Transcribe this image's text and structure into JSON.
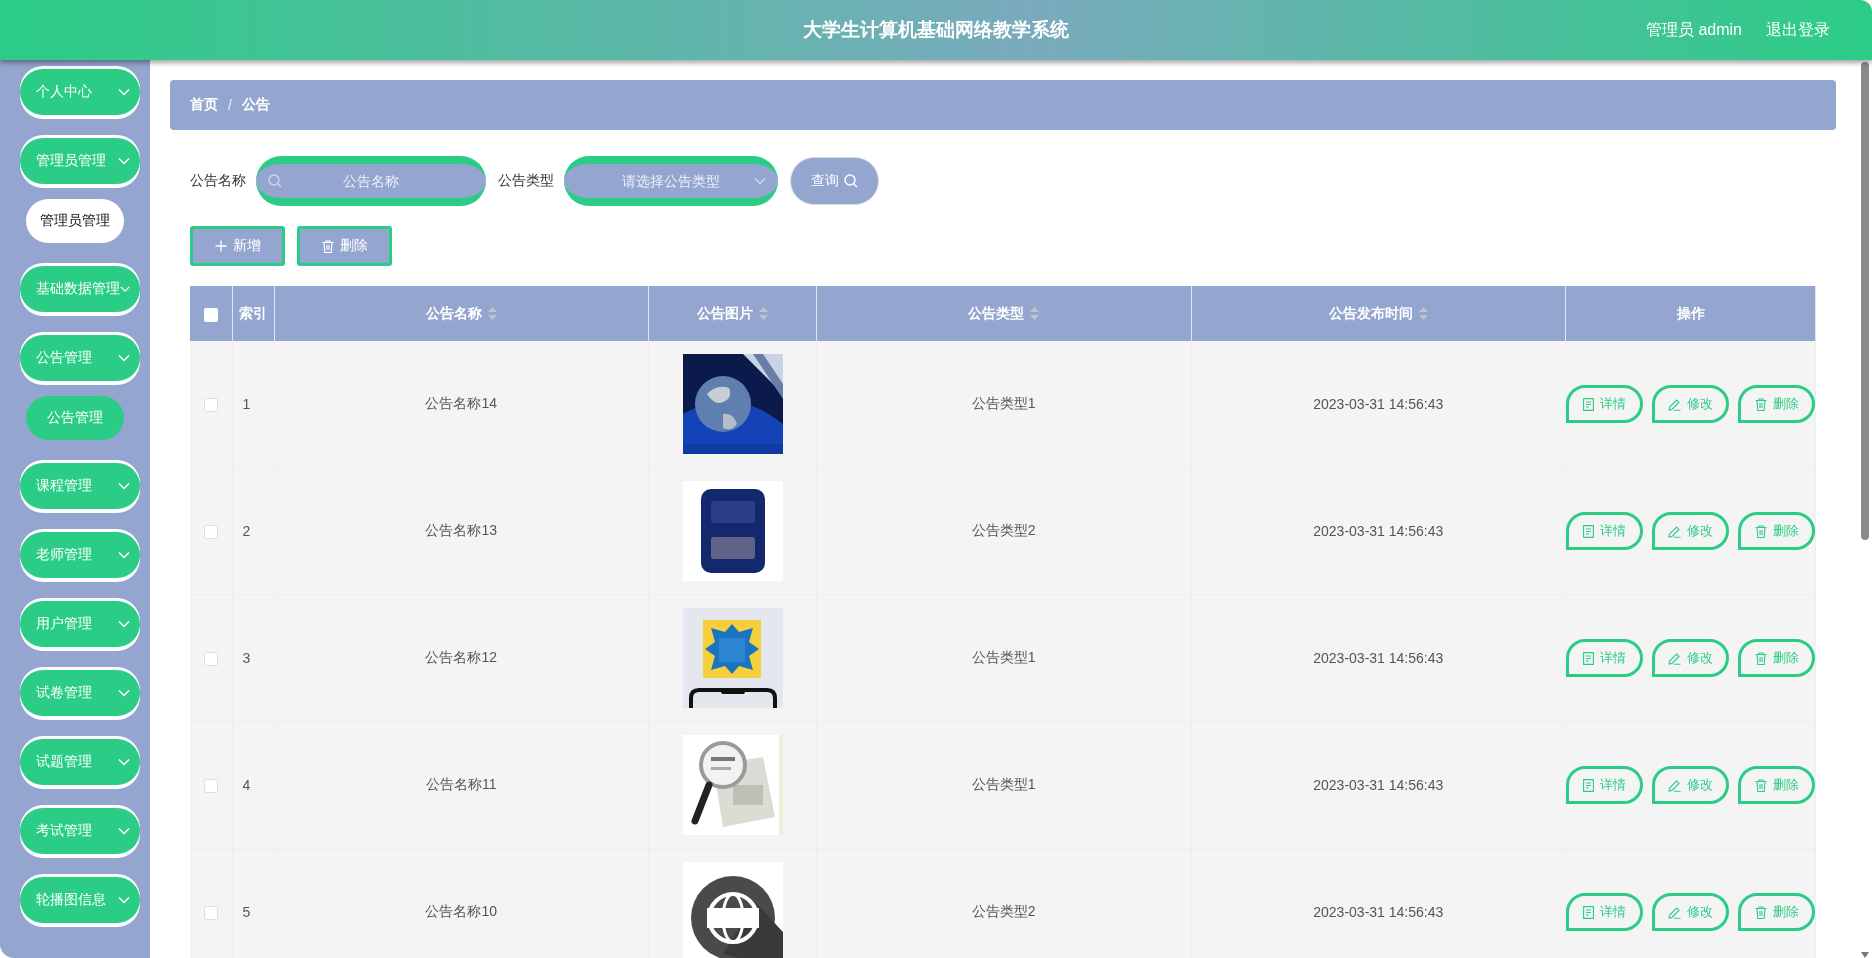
{
  "header": {
    "title": "大学生计算机基础网络教学系统",
    "user": "管理员 admin",
    "logout": "退出登录"
  },
  "sidebar": {
    "items": [
      {
        "label": "个人中心"
      },
      {
        "label": "管理员管理",
        "children": [
          {
            "label": "管理员管理",
            "selected": false
          }
        ]
      },
      {
        "label": "基础数据管理"
      },
      {
        "label": "公告管理",
        "children": [
          {
            "label": "公告管理",
            "selected": true
          }
        ]
      },
      {
        "label": "课程管理"
      },
      {
        "label": "老师管理"
      },
      {
        "label": "用户管理"
      },
      {
        "label": "试卷管理"
      },
      {
        "label": "试题管理"
      },
      {
        "label": "考试管理"
      },
      {
        "label": "轮播图信息"
      }
    ]
  },
  "breadcrumb": {
    "items": [
      "首页",
      "公告"
    ],
    "separator": "/"
  },
  "search": {
    "fields": [
      {
        "label": "公告名称",
        "placeholder": "公告名称",
        "kind": "text"
      },
      {
        "label": "公告类型",
        "placeholder": "请选择公告类型",
        "kind": "select"
      }
    ],
    "button": "查询"
  },
  "actions": [
    {
      "label": "新增",
      "kind": "add"
    },
    {
      "label": "删除",
      "kind": "delete"
    }
  ],
  "table": {
    "columns": [
      {
        "kind": "checkbox",
        "checked": false
      },
      {
        "label": "索引",
        "sortable": false
      },
      {
        "label": "公告名称",
        "sortable": true
      },
      {
        "label": "公告图片",
        "sortable": true
      },
      {
        "label": "公告类型",
        "sortable": true
      },
      {
        "label": "公告发布时间",
        "sortable": true
      },
      {
        "label": "操作",
        "sortable": false
      }
    ],
    "rows": [
      {
        "checked": false,
        "index": "1",
        "name": "公告名称14",
        "type": "公告类型1",
        "time": "2023-03-31 14:56:43",
        "actions": [
          {
            "label": "详情",
            "kind": "detail"
          },
          {
            "label": "修改",
            "kind": "edit"
          },
          {
            "label": "删除",
            "kind": "delete"
          }
        ]
      },
      {
        "checked": false,
        "index": "2",
        "name": "公告名称13",
        "type": "公告类型2",
        "time": "2023-03-31 14:56:43",
        "actions": [
          {
            "label": "详情",
            "kind": "detail"
          },
          {
            "label": "修改",
            "kind": "edit"
          },
          {
            "label": "删除",
            "kind": "delete"
          }
        ]
      },
      {
        "checked": false,
        "index": "3",
        "name": "公告名称12",
        "type": "公告类型1",
        "time": "2023-03-31 14:56:43",
        "actions": [
          {
            "label": "详情",
            "kind": "detail"
          },
          {
            "label": "修改",
            "kind": "edit"
          },
          {
            "label": "删除",
            "kind": "delete"
          }
        ]
      },
      {
        "checked": false,
        "index": "4",
        "name": "公告名称11",
        "type": "公告类型1",
        "time": "2023-03-31 14:56:43",
        "actions": [
          {
            "label": "详情",
            "kind": "detail"
          },
          {
            "label": "修改",
            "kind": "edit"
          },
          {
            "label": "删除",
            "kind": "delete"
          }
        ]
      },
      {
        "checked": false,
        "index": "5",
        "name": "公告名称10",
        "type": "公告类型2",
        "time": "2023-03-31 14:56:43",
        "actions": [
          {
            "label": "详情",
            "kind": "detail"
          },
          {
            "label": "修改",
            "kind": "edit"
          },
          {
            "label": "删除",
            "kind": "delete"
          }
        ]
      }
    ]
  }
}
